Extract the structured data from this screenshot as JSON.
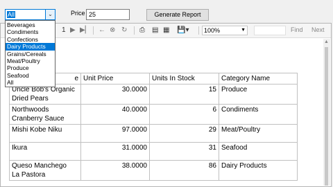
{
  "category_combo": {
    "value": "All"
  },
  "price": {
    "label": "Price",
    "value": "25"
  },
  "generate_button": {
    "label": "Generate Report"
  },
  "toolbar": {
    "page_fragment": "1",
    "zoom": "100%",
    "find_label": "Find",
    "next_label": "Next"
  },
  "category_options": [
    "Beverages",
    "Condiments",
    "Confections",
    "Dairy Products",
    "Grains/Cereals",
    "Meat/Poultry",
    "Produce",
    "Seafood",
    "All"
  ],
  "selected_option_index": 3,
  "table": {
    "headers": [
      "Product Name",
      "Unit Price",
      "Units In Stock",
      "Category Name"
    ],
    "header_visible_fragment": "e",
    "rows": [
      {
        "name_l1": "Uncle Bob's Organic",
        "name_l2": "Dried Pears",
        "price": "30.0000",
        "stock": "15",
        "category": "Produce"
      },
      {
        "name_l1": "Northwoods",
        "name_l2": "Cranberry Sauce",
        "price": "40.0000",
        "stock": "6",
        "category": "Condiments"
      },
      {
        "name_l1": "Mishi Kobe Niku",
        "name_l2": "",
        "price": "97.0000",
        "stock": "29",
        "category": "Meat/Poultry"
      },
      {
        "name_l1": "Ikura",
        "name_l2": "",
        "price": "31.0000",
        "stock": "31",
        "category": "Seafood"
      },
      {
        "name_l1": "Queso Manchego",
        "name_l2": "La Pastora",
        "price": "38.0000",
        "stock": "86",
        "category": "Dairy Products"
      }
    ]
  }
}
